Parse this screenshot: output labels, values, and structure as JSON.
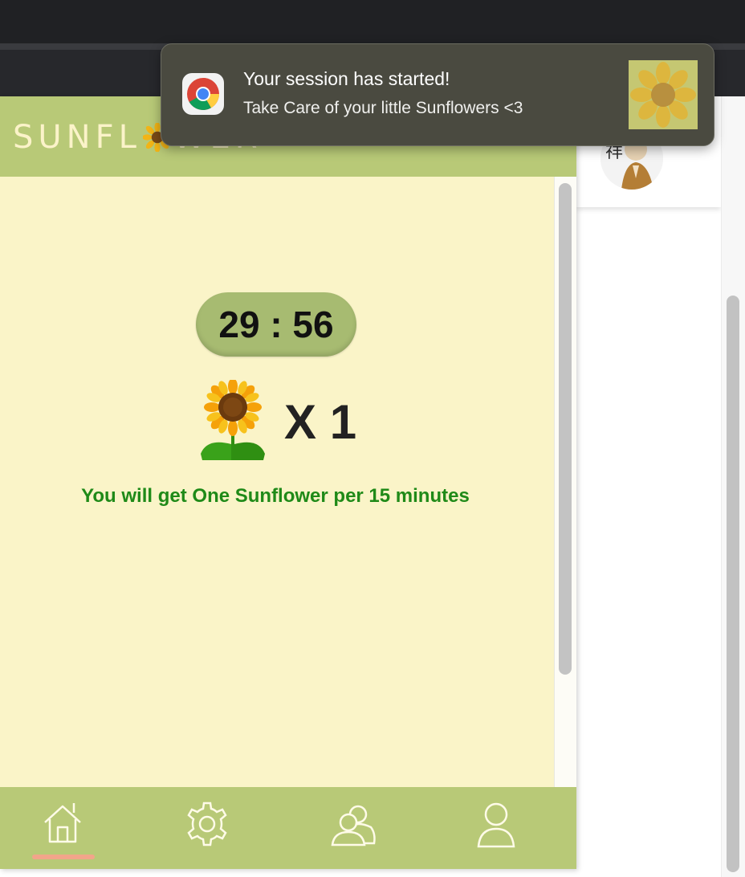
{
  "notification": {
    "title": "Your session has started!",
    "body": "Take Care of your little Sunflowers <3",
    "app_icon": "chrome-icon"
  },
  "popup": {
    "logo_text_start": "SUNFL",
    "logo_text_end": "WER",
    "timer": "29 : 56",
    "sunflower_count": "X 1",
    "info_text": "You will get One Sunflower per 15 minutes",
    "nav": [
      {
        "name": "home",
        "icon": "home-icon",
        "active": true
      },
      {
        "name": "settings",
        "icon": "gear-icon",
        "active": false
      },
      {
        "name": "friends",
        "icon": "users-icon",
        "active": false
      },
      {
        "name": "profile",
        "icon": "user-icon",
        "active": false
      }
    ]
  },
  "colors": {
    "header_green": "#b8c977",
    "popup_bg": "#faf4c8",
    "timer_bg": "#a7bb71",
    "info_green": "#1f8a18",
    "active_underline": "#f2a58a"
  }
}
